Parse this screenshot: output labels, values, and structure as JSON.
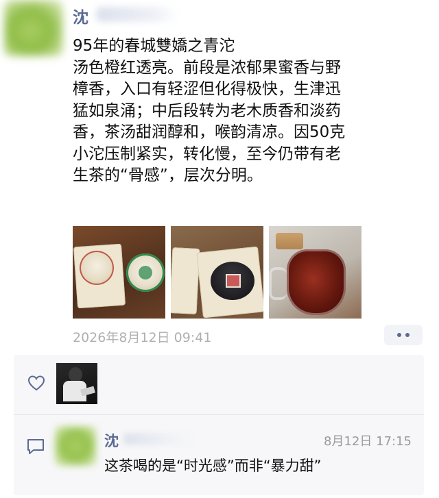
{
  "post": {
    "author_name": "沈",
    "title_line": "95年的春城雙嬌之青沱",
    "body_lines": [
      "汤色橙红透亮。前段是浓郁果蜜香与野",
      "樟香，入口有轻涩但化得极快，生津迅",
      "猛如泉涌；中后段转为老木质香和淡药",
      "香，茶汤甜润醇和，喉韵清凉。因50克",
      "小沱压制紧实，转化慢，至今仍带有老",
      "生茶的“骨感”，层次分明。"
    ],
    "photos": [
      {
        "name": "two-tuocha-cakes-on-wrappers"
      },
      {
        "name": "unwrapped-dark-tuocha"
      },
      {
        "name": "tea-in-glass-pitcher"
      }
    ],
    "timestamp": "2026年8月12日 09:41",
    "more_icon": "ellipsis-icon"
  },
  "interactions": {
    "like_icon": "heart-outline-icon",
    "comment_icon": "speech-bubble-icon",
    "comment": {
      "name": "沈",
      "time": "8月12日 17:15",
      "text": "这茶喝的是“时光感”而非“暴力甜”"
    }
  },
  "colors": {
    "name_blue": "#5a6a92",
    "timestamp_gray": "#b0b0b0",
    "panel_bg": "#f7f7f9"
  }
}
